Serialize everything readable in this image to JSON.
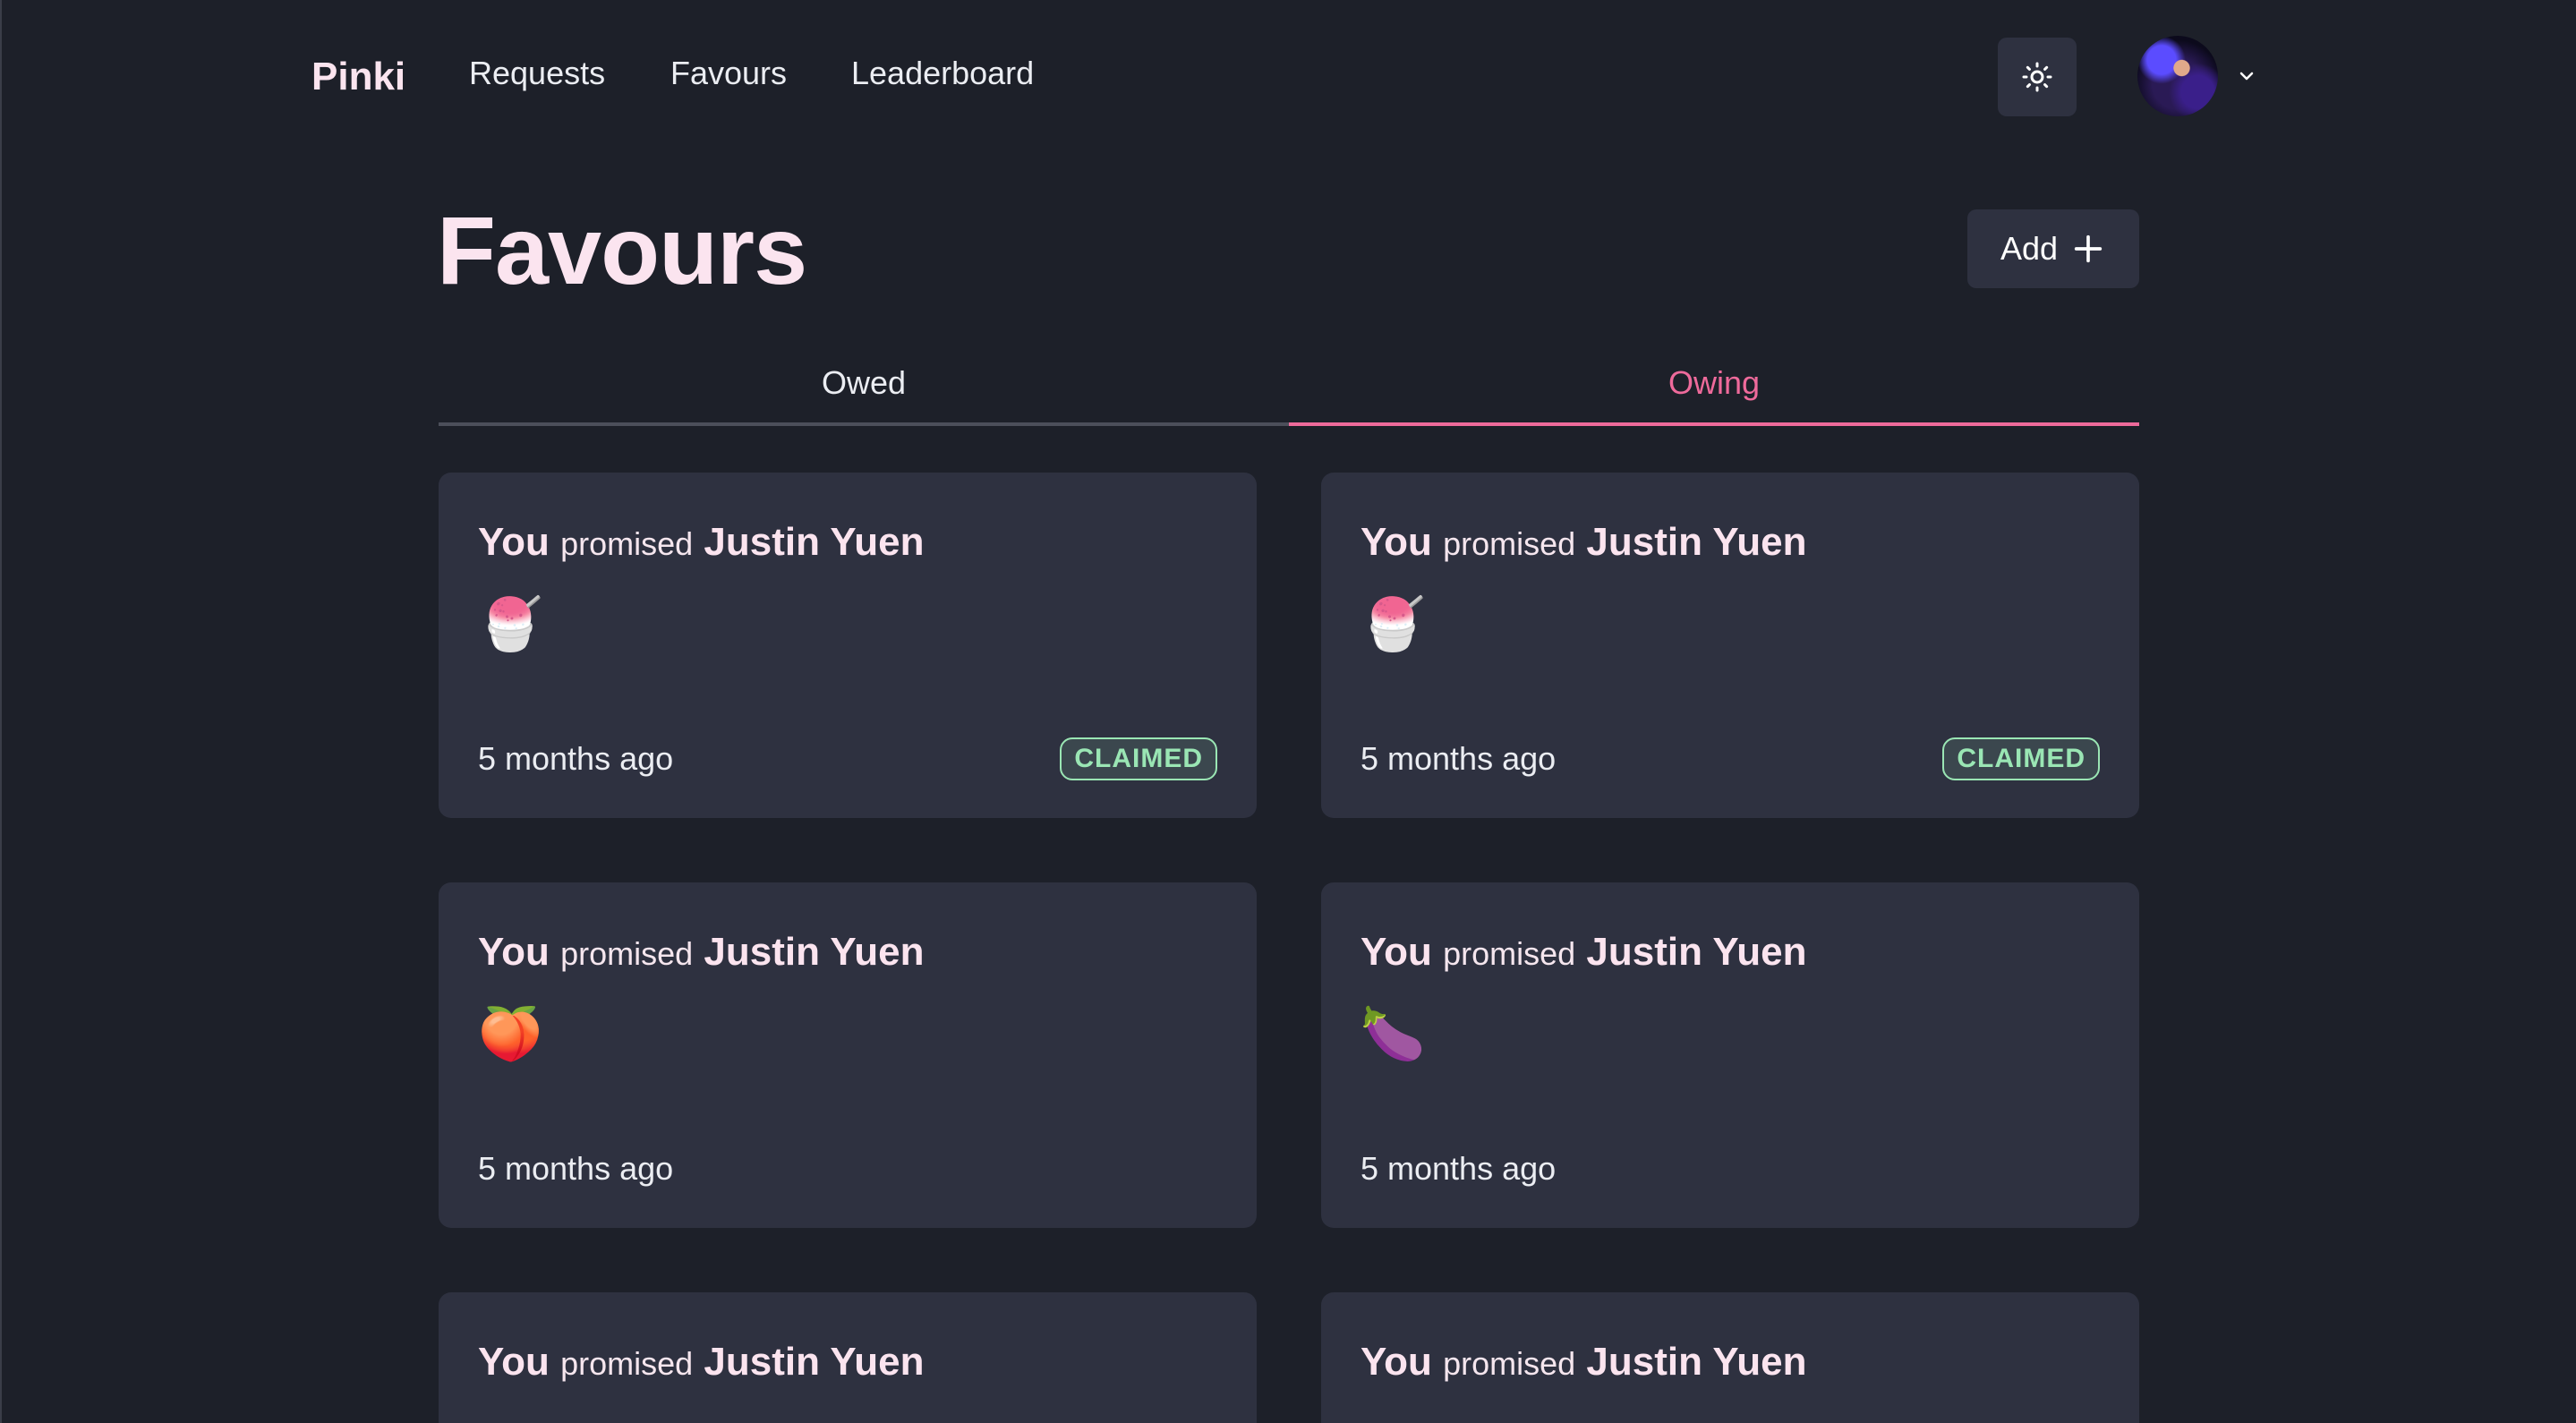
{
  "nav": {
    "brand": "Pinki",
    "links": [
      "Requests",
      "Favours",
      "Leaderboard"
    ]
  },
  "page": {
    "title": "Favours",
    "add_label": "Add"
  },
  "tabs": [
    {
      "label": "Owed",
      "active": false
    },
    {
      "label": "Owing",
      "active": true
    }
  ],
  "colors": {
    "accent": "#ee6a9b",
    "claimed": "#9ae6b4",
    "card_bg": "#2e3140",
    "page_bg": "#1d2029"
  },
  "cards": [
    {
      "actor": "You",
      "verb": "promised",
      "target": "Justin Yuen",
      "item": "🍧",
      "time": "5 months ago",
      "status": "CLAIMED"
    },
    {
      "actor": "You",
      "verb": "promised",
      "target": "Justin Yuen",
      "item": "🍧",
      "time": "5 months ago",
      "status": "CLAIMED"
    },
    {
      "actor": "You",
      "verb": "promised",
      "target": "Justin Yuen",
      "item": "🍑",
      "time": "5 months ago",
      "status": ""
    },
    {
      "actor": "You",
      "verb": "promised",
      "target": "Justin Yuen",
      "item": "🍆",
      "time": "5 months ago",
      "status": ""
    },
    {
      "actor": "You",
      "verb": "promised",
      "target": "Justin Yuen",
      "item": "",
      "time": "",
      "status": ""
    },
    {
      "actor": "You",
      "verb": "promised",
      "target": "Justin Yuen",
      "item": "",
      "time": "",
      "status": ""
    }
  ]
}
